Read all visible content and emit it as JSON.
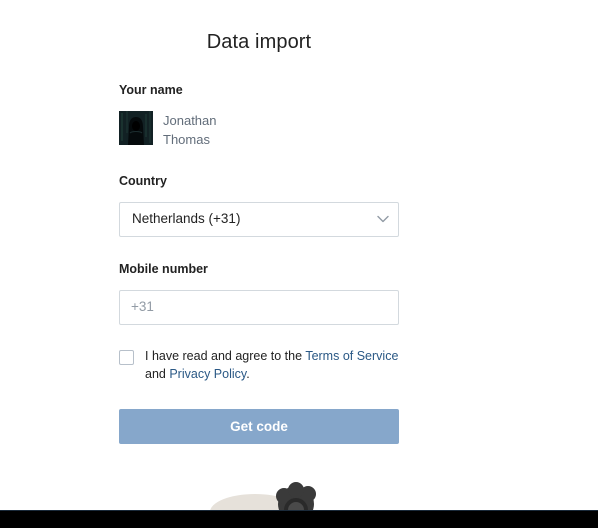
{
  "page": {
    "title": "Data import"
  },
  "profile": {
    "label": "Your name",
    "first_name": "Jonathan",
    "last_name": "Thomas"
  },
  "country": {
    "label": "Country",
    "selected": "Netherlands (+31)"
  },
  "mobile": {
    "label": "Mobile number",
    "placeholder": "+31",
    "value": ""
  },
  "agreement": {
    "checked": false,
    "text_before": "I have read and agree to the",
    "terms_link": "Terms of Service",
    "text_middle": "and",
    "privacy_link": "Privacy Policy",
    "text_after": "."
  },
  "action": {
    "get_code_label": "Get code"
  },
  "colors": {
    "link": "#2a5885",
    "button_disabled": "#86a7cb",
    "border": "#d3d9de",
    "muted_text": "#626d7a"
  },
  "icons": {
    "dropdown": "chevron-down-icon",
    "checkbox": "checkbox-icon"
  }
}
